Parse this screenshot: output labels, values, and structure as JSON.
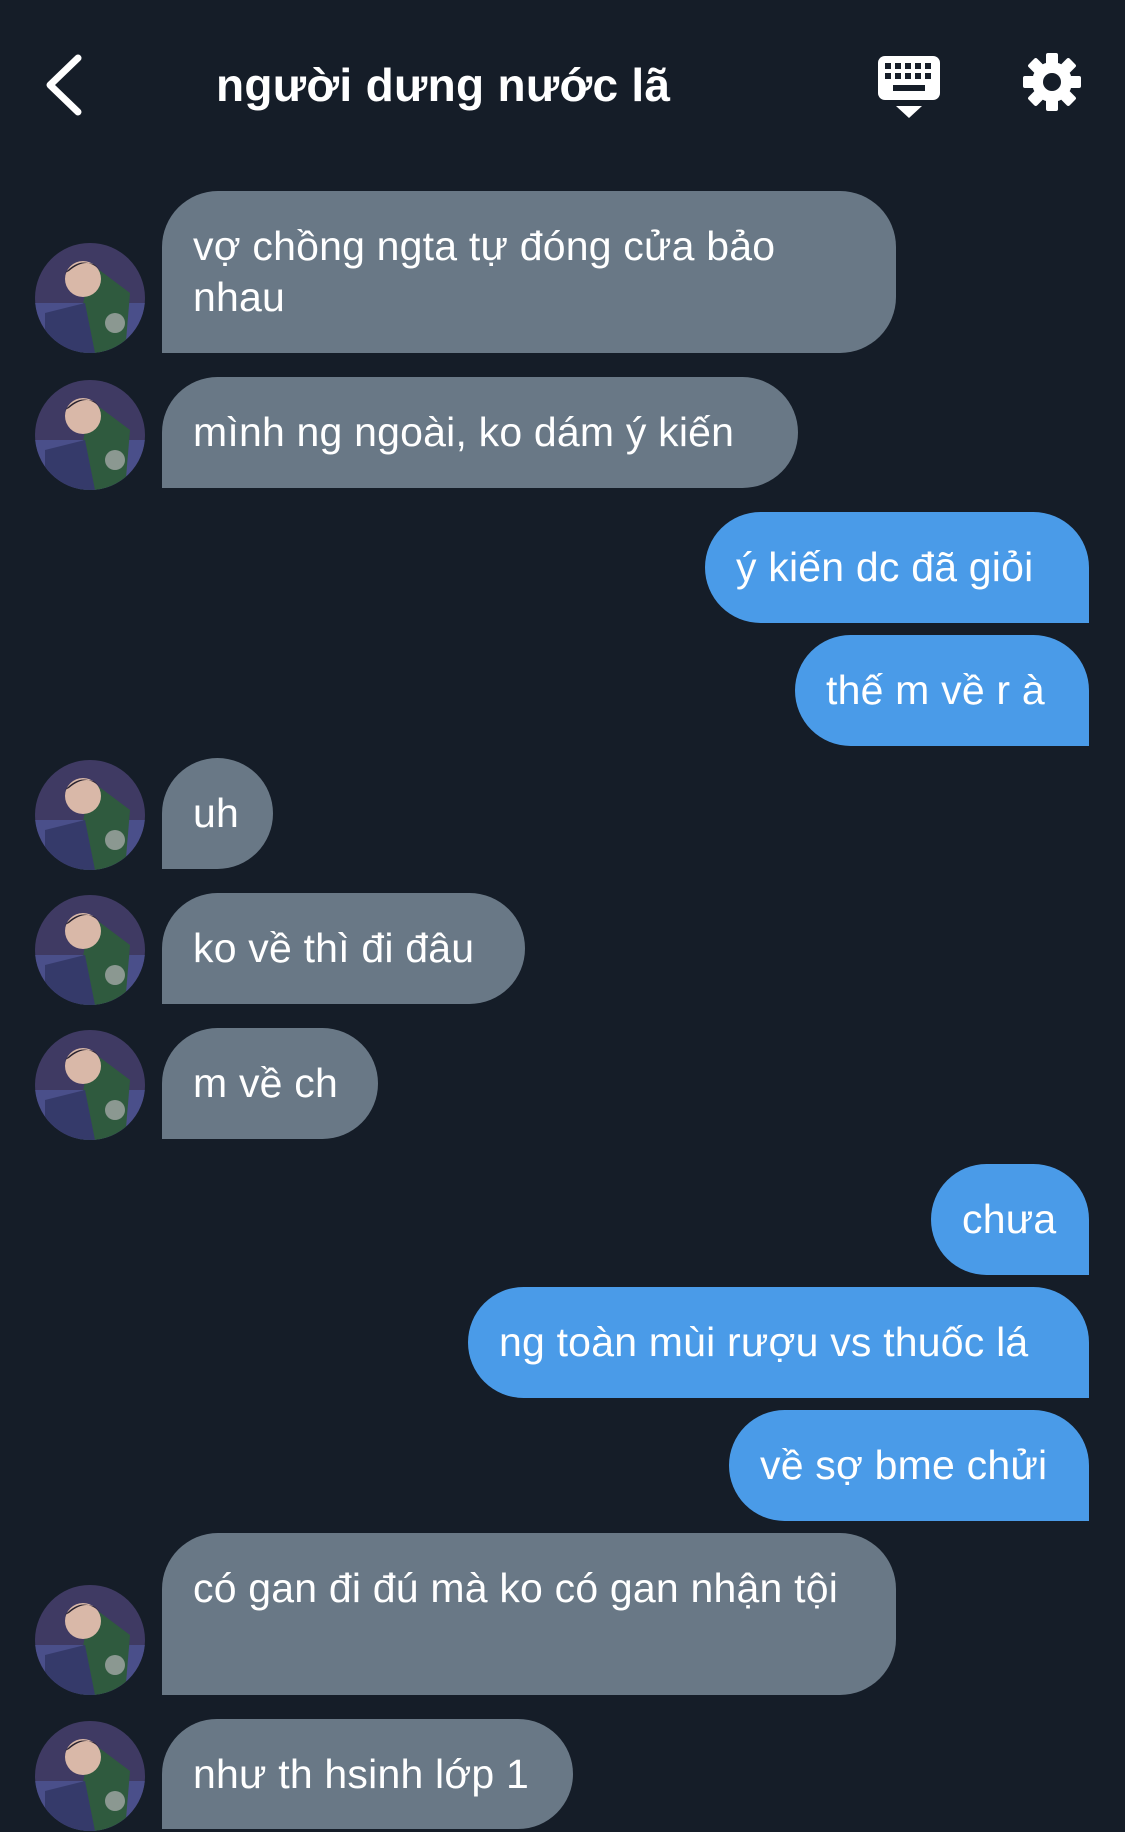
{
  "header": {
    "title": "người dưng nước lã",
    "back_icon": "chevron-left-icon",
    "keyboard_icon": "keyboard-hide-icon",
    "settings_icon": "gear-icon"
  },
  "colors": {
    "background": "#151d28",
    "incoming_bubble": "#697886",
    "outgoing_bubble": "#4a9be8",
    "text": "#ffffff"
  },
  "messages": [
    {
      "side": "in",
      "text": "vợ chồng ngta tự đóng cửa bảo nhau"
    },
    {
      "side": "in",
      "text": "mình ng ngoài, ko dám ý kiến"
    },
    {
      "side": "out",
      "text": "ý kiến dc đã giỏi"
    },
    {
      "side": "out",
      "text": "thế m về r à"
    },
    {
      "side": "in",
      "text": "uh"
    },
    {
      "side": "in",
      "text": "ko về thì đi đâu"
    },
    {
      "side": "in",
      "text": "m về ch"
    },
    {
      "side": "out",
      "text": "chưa"
    },
    {
      "side": "out",
      "text": "ng toàn mùi rượu vs thuốc lá"
    },
    {
      "side": "out",
      "text": "về sợ bme chửi"
    },
    {
      "side": "in",
      "text": "có gan đi đú mà ko có gan nhận tội"
    },
    {
      "side": "in",
      "text": "như th hsinh lớp 1"
    }
  ]
}
